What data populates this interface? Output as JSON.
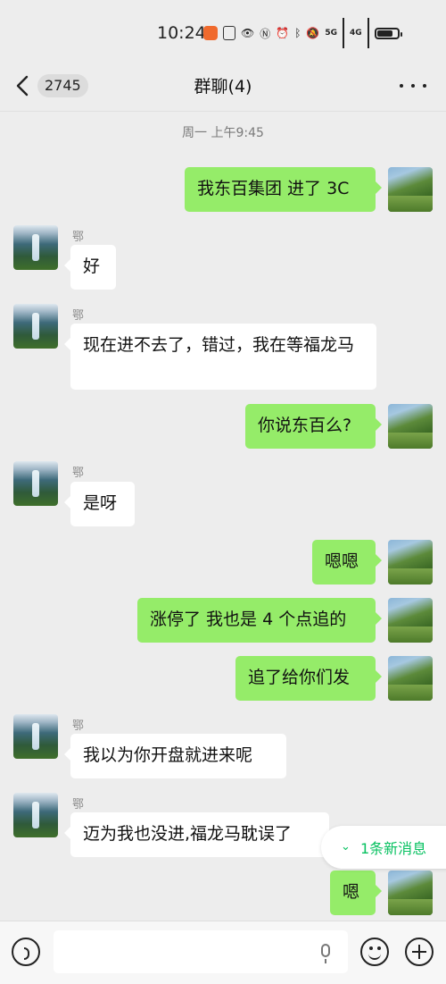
{
  "status_bar": {
    "time": "10:24",
    "network_5g": "5G",
    "network_4g": "4G"
  },
  "header": {
    "unread_count": "2745",
    "title": "群聊(4)"
  },
  "chat": {
    "timestamp": "周一 上午9:45",
    "messages": [
      {
        "side": "out",
        "text": "我东百集团 进了 3C"
      },
      {
        "side": "in",
        "sender": "鄂",
        "text": "好"
      },
      {
        "side": "in",
        "sender": "鄂",
        "text": "现在进不去了，错过，我在等福龙马"
      },
      {
        "side": "out",
        "text": "你说东百么?"
      },
      {
        "side": "in",
        "sender": "鄂",
        "text": "是呀"
      },
      {
        "side": "out",
        "text": "嗯嗯"
      },
      {
        "side": "out",
        "text": "涨停了 我也是 4 个点追的"
      },
      {
        "side": "out",
        "text": "追了给你们发"
      },
      {
        "side": "in",
        "sender": "鄂",
        "text": "我以为你开盘就进来呢"
      },
      {
        "side": "in",
        "sender": "鄂",
        "text": "迈为我也没进,福龙马耽误了"
      },
      {
        "side": "out",
        "text": "嗯"
      }
    ],
    "new_message_label": "1条新消息"
  },
  "input_bar": {
    "message_value": ""
  },
  "colors": {
    "outgoing_bubble": "#95ec69",
    "incoming_bubble": "#ffffff",
    "background": "#ededed",
    "accent": "#07c160"
  }
}
